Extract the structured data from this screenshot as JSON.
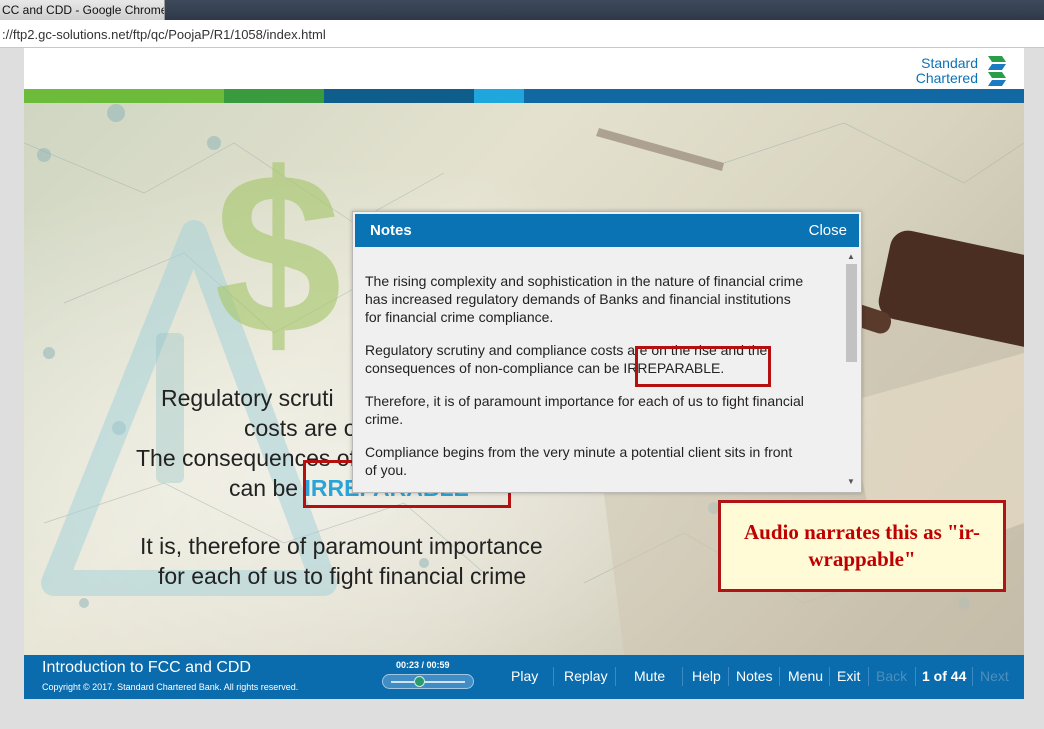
{
  "browser": {
    "tab_title": "CC and CDD - Google Chrome",
    "address": "://ftp2.gc-solutions.net/ftp/qc/PoojaP/R1/1058/index.html"
  },
  "logo": {
    "line1": "Standard",
    "line2": "Chartered"
  },
  "colors": {
    "brand_blue": "#0a73b4",
    "stripe_green_light": "#6dbb3a",
    "stripe_green_dark": "#3a9a3e",
    "stripe_navy": "#0f5d8a",
    "stripe_cyan": "#1fa6dd",
    "stripe_blue": "#1168a3",
    "highlight_red": "#b51010"
  },
  "slide": {
    "line1": "Regulatory scruti",
    "line2": "costs are on the rise",
    "line3": "The consequences of non-compliance",
    "line4_prefix": "can be",
    "line4_highlight": "IRREPARABLE",
    "line5": "It is, therefore of paramount importance",
    "line6": "for each of us to fight financial crime"
  },
  "notes": {
    "title": "Notes",
    "close": "Close",
    "paragraphs": [
      "The rising complexity and sophistication in the nature of financial crime has increased regulatory demands of Banks and financial institutions for financial crime compliance.",
      "Regulatory scrutiny and compliance costs are on the rise and the consequences of non-compliance can be IRREPARABLE.",
      "Therefore, it is of paramount importance for each of us to fight financial crime.",
      "Compliance begins from the very minute a potential client sits in front of you."
    ]
  },
  "annotation": {
    "text": "Audio narrates this as \"ir-wrappable\""
  },
  "footer": {
    "course_title": "Introduction to FCC and CDD",
    "copyright": "Copyright © 2017. Standard Chartered Bank. All rights reserved.",
    "time": "00:23 / 00:59",
    "progress": 0.39,
    "buttons": {
      "play": "Play",
      "replay": "Replay",
      "mute": "Mute",
      "help": "Help",
      "notes": "Notes",
      "menu": "Menu",
      "exit": "Exit",
      "back": "Back",
      "page": "1 of 44",
      "next": "Next"
    }
  }
}
